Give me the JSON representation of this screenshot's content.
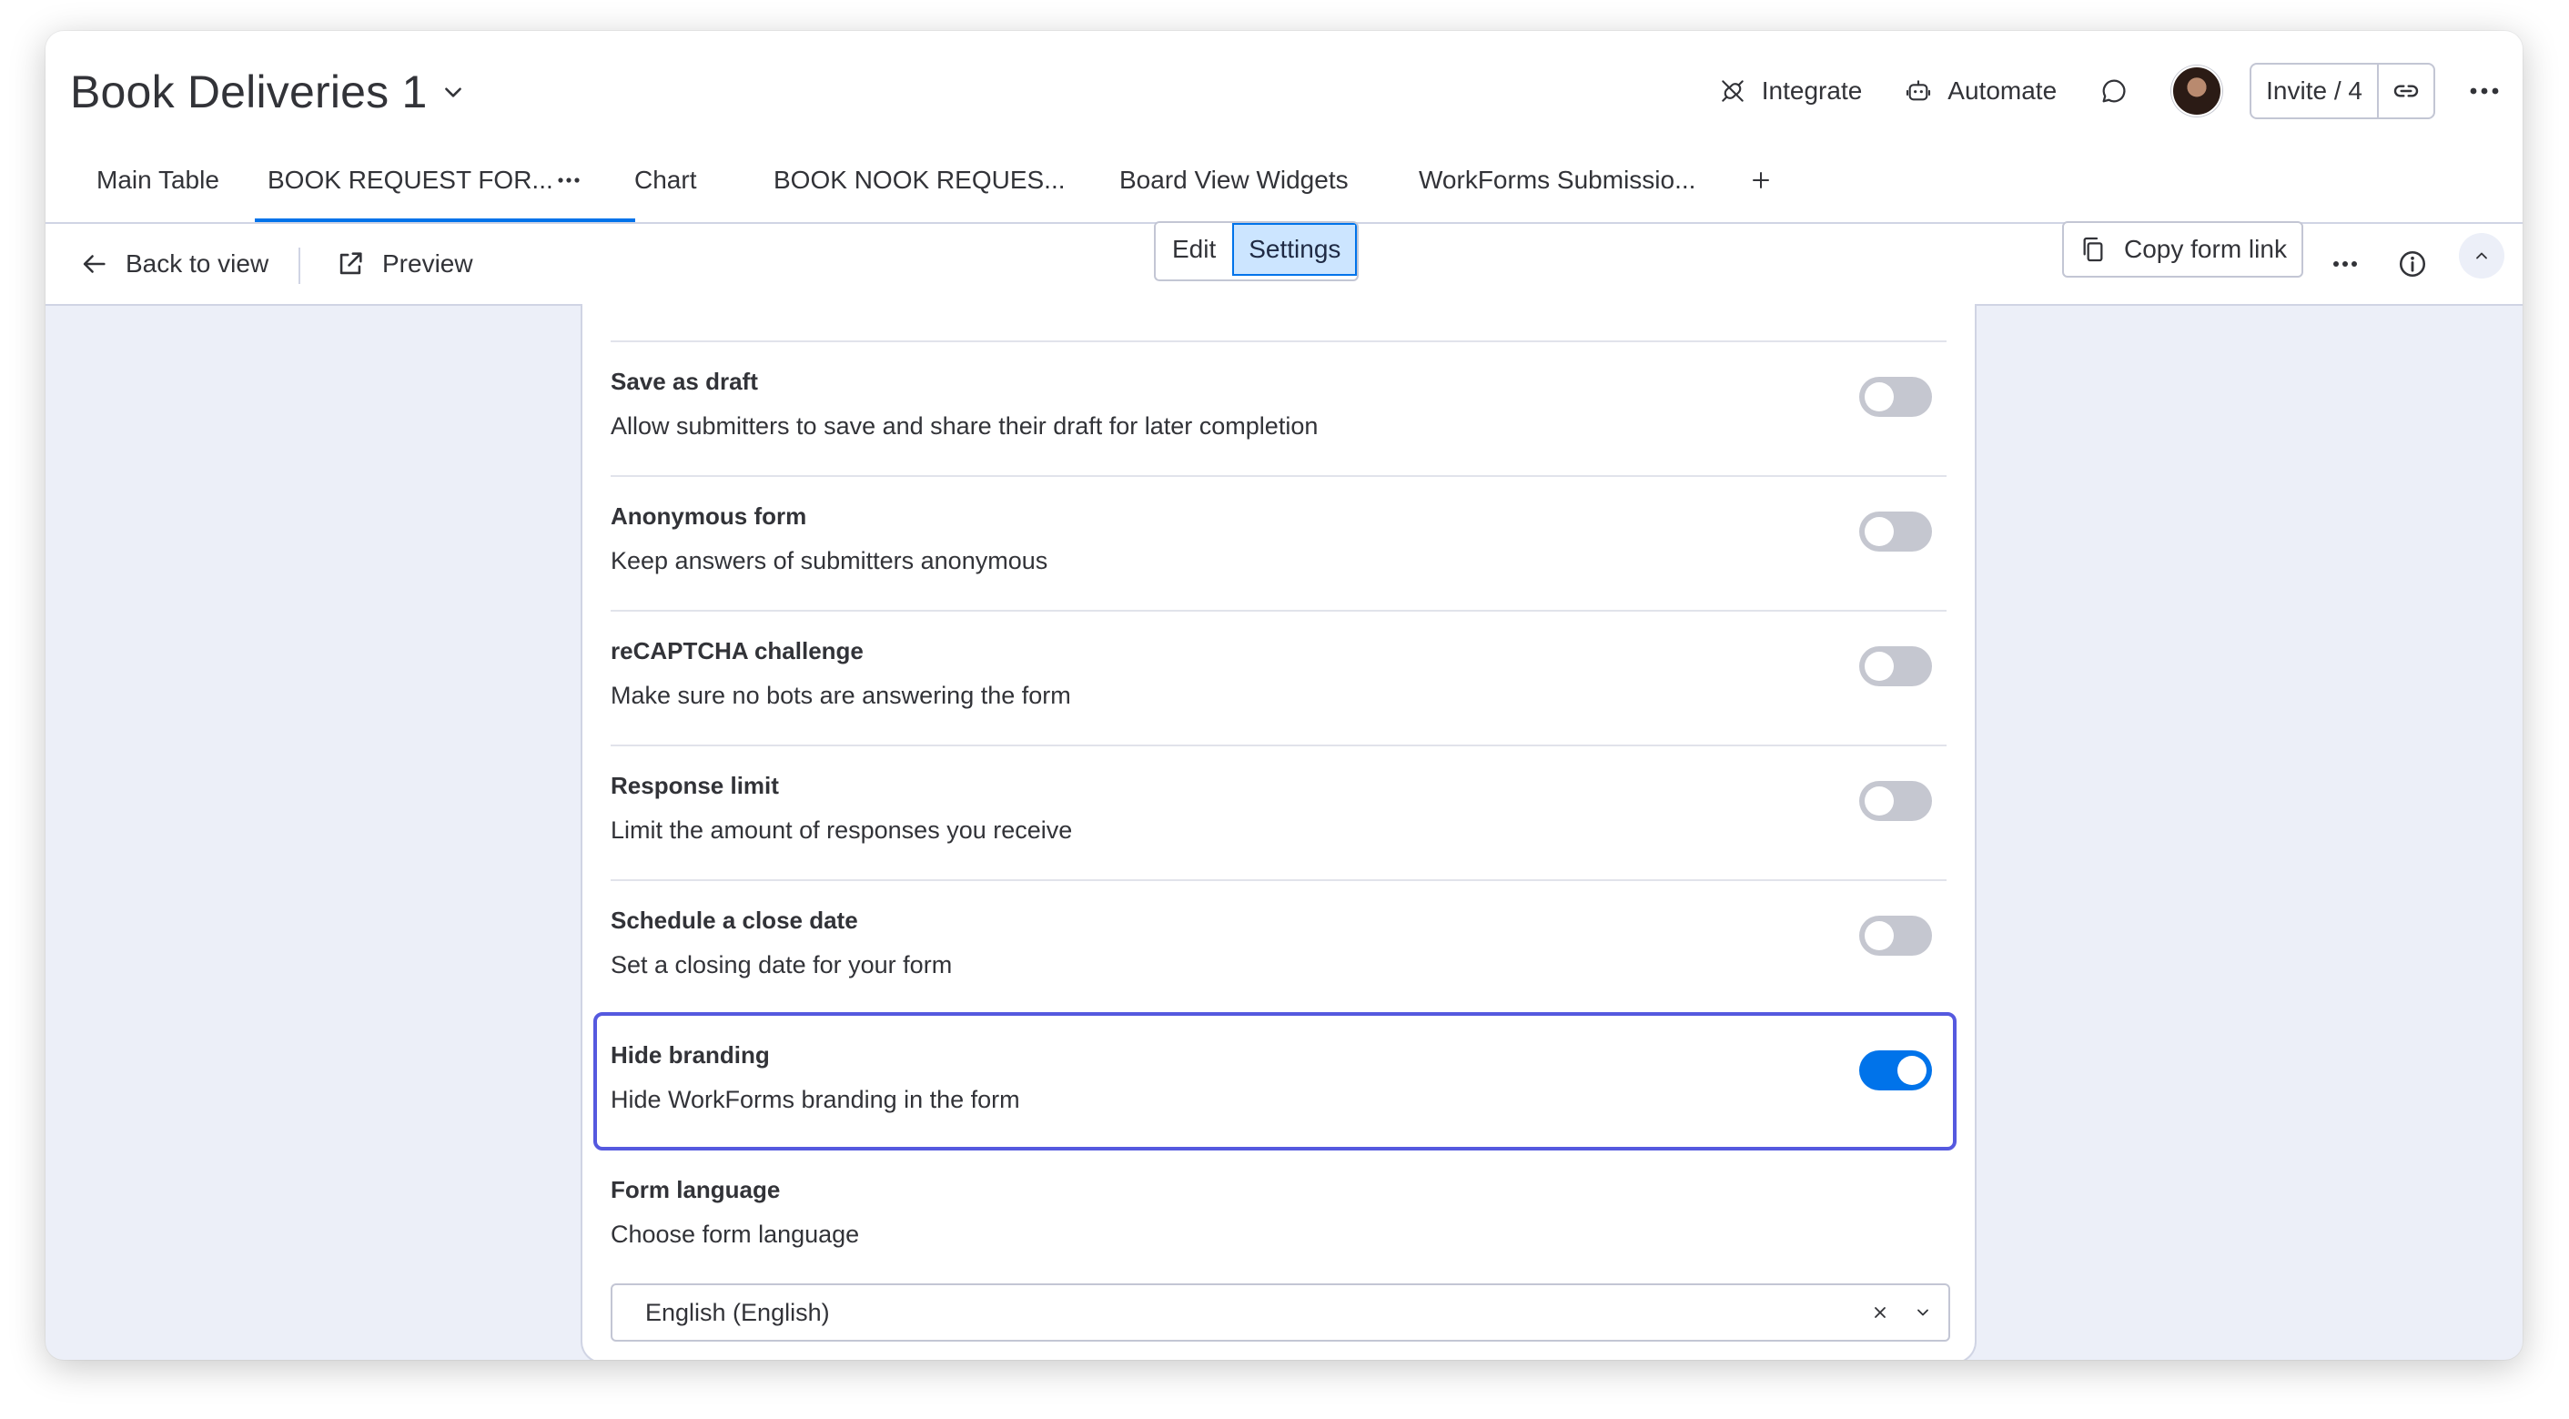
{
  "header": {
    "board_title": "Book Deliveries 1",
    "integrate_label": "Integrate",
    "automate_label": "Automate",
    "invite_label": "Invite / 4"
  },
  "tabs": [
    {
      "label": "Main Table"
    },
    {
      "label": "BOOK REQUEST FOR..."
    },
    {
      "label": "Chart"
    },
    {
      "label": "BOOK NOOK REQUES..."
    },
    {
      "label": "Board View Widgets"
    },
    {
      "label": "WorkForms Submissio..."
    }
  ],
  "toolbar": {
    "back_label": "Back to view",
    "preview_label": "Preview",
    "edit_label": "Edit",
    "settings_label": "Settings",
    "copy_link_label": "Copy form link"
  },
  "settings": [
    {
      "title": "Save as draft",
      "desc": "Allow submitters to save and share their draft for later completion",
      "enabled": false
    },
    {
      "title": "Anonymous form",
      "desc": "Keep answers of submitters anonymous",
      "enabled": false
    },
    {
      "title": "reCAPTCHA challenge",
      "desc": "Make sure no bots are answering the form",
      "enabled": false
    },
    {
      "title": "Response limit",
      "desc": "Limit the amount of responses you receive",
      "enabled": false
    },
    {
      "title": "Schedule a close date",
      "desc": "Set a closing date for your form",
      "enabled": false
    },
    {
      "title": "Hide branding",
      "desc": "Hide WorkForms branding in the form",
      "enabled": true
    }
  ],
  "language": {
    "title": "Form language",
    "desc": "Choose form language",
    "selected": "English (English)"
  },
  "colors": {
    "accent": "#0073ea",
    "highlight": "#5559df",
    "toggle_off": "#c5c7d0"
  },
  "icons": [
    "chevron-down-icon",
    "integrate-icon",
    "automate-icon",
    "chat-icon",
    "link-icon",
    "more-icon",
    "add-icon",
    "back-arrow-icon",
    "external-link-icon",
    "copy-icon",
    "info-icon",
    "collapse-icon",
    "clear-icon"
  ]
}
